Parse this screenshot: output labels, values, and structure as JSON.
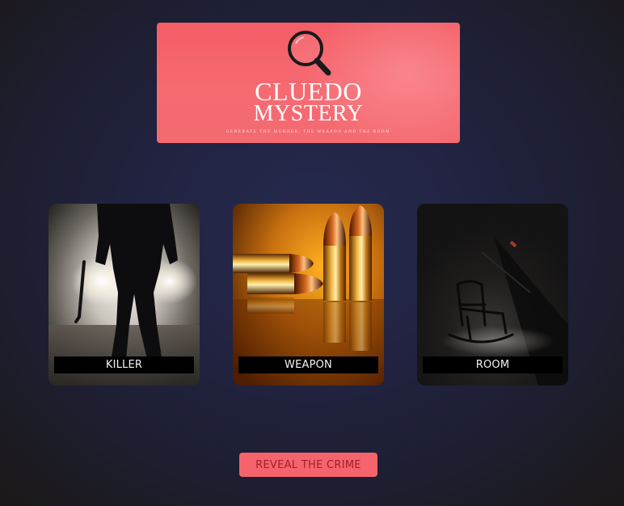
{
  "header": {
    "title_line1": "CLUEDO",
    "title_line2": "MYSTERY",
    "tagline": "Generate the murder, the weapon and the room",
    "icon": "magnifying-glass-icon"
  },
  "cards": [
    {
      "id": "killer",
      "label": "KILLER",
      "image": "silhouette-with-crowbar-image"
    },
    {
      "id": "weapon",
      "label": "WEAPON",
      "image": "bullets-image"
    },
    {
      "id": "room",
      "label": "ROOM",
      "image": "attic-rocking-chair-image"
    }
  ],
  "actions": {
    "reveal_label": "REVEAL THE CRIME"
  },
  "colors": {
    "background": "#20223e",
    "banner": "#f45d66",
    "button": "#f5646c",
    "button_text": "#a01f2c",
    "card_label_bg": "#000000"
  }
}
